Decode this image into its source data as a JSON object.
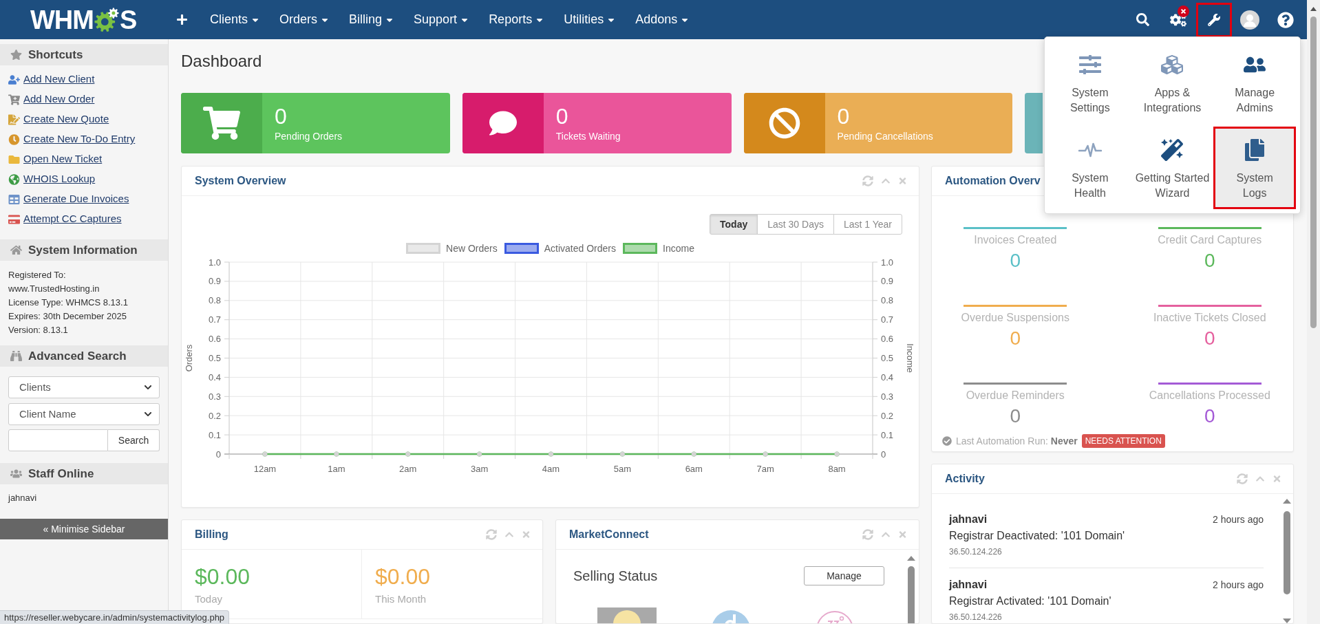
{
  "header": {
    "logo": {
      "text_start": "WHM",
      "text_end": "S"
    },
    "menu": [
      "Clients",
      "Orders",
      "Billing",
      "Support",
      "Reports",
      "Utilities",
      "Addons"
    ],
    "toolbar": [
      {
        "kind": "search",
        "highlighted": false,
        "expanded": false,
        "alert": false
      },
      {
        "kind": "settings",
        "highlighted": false,
        "expanded": false,
        "alert": true
      },
      {
        "kind": "tools",
        "highlighted": true,
        "expanded": true,
        "alert": false
      },
      {
        "kind": "avatar",
        "highlighted": false,
        "expanded": false,
        "alert": false
      },
      {
        "kind": "help",
        "highlighted": false,
        "expanded": false,
        "alert": false
      }
    ]
  },
  "tools_menu": {
    "items": [
      {
        "label": "System\nSettings",
        "highlighted": false
      },
      {
        "label": "Apps &\nIntegrations",
        "highlighted": false
      },
      {
        "label": "Manage\nAdmins",
        "highlighted": false
      },
      {
        "label": "System\nHealth",
        "highlighted": false
      },
      {
        "label": "Getting Started\nWizard",
        "highlighted": false
      },
      {
        "label": "System\nLogs",
        "highlighted": true
      }
    ]
  },
  "sidebar": {
    "shortcuts": {
      "title": "Shortcuts",
      "links": [
        "Add New Client",
        "Add New Order",
        "Create New Quote",
        "Create New To-Do Entry",
        "Open New Ticket",
        "WHOIS Lookup",
        "Generate Due Invoices",
        "Attempt CC Captures"
      ]
    },
    "system_information": {
      "title": "System Information",
      "lines": [
        "Registered To:",
        "www.TrustedHosting.in",
        "License Type: WHMCS 8.13.1",
        "Expires: 30th December 2025",
        "Version: 8.13.1"
      ]
    },
    "advanced_search": {
      "title": "Advanced Search",
      "search_type": "Clients",
      "search_field": "Client Name",
      "button": "Search"
    },
    "staff_online": {
      "title": "Staff Online",
      "names": [
        "jahnavi"
      ]
    },
    "minimise_button": "« Minimise Sidebar"
  },
  "page_title": "Dashboard",
  "stat_cards": [
    {
      "value": "0",
      "label": "Pending Orders",
      "color": "#5dc45d",
      "icon_panel": {
        "color": "#4cad4c"
      }
    },
    {
      "value": "0",
      "label": "Tickets Waiting",
      "color": "#ea559a",
      "icon_panel": {
        "color": "#d71c6c"
      }
    },
    {
      "value": "0",
      "label": "Pending Cancellations",
      "color": "#eaae55",
      "icon_panel": {
        "color": "#d4891c"
      }
    },
    {
      "color": "#6bb4b8"
    }
  ],
  "system_overview": {
    "title": "System Overview",
    "ranges": [
      {
        "label": "Today",
        "selected": true
      },
      {
        "label": "Last 30 Days",
        "selected": false
      },
      {
        "label": "Last 1 Year",
        "selected": false
      }
    ],
    "chart_data": {
      "type": "line",
      "ylabel": "Orders",
      "categories": [
        "12am",
        "1am",
        "2am",
        "3am",
        "4am",
        "5am",
        "6am",
        "7am",
        "8am"
      ],
      "series": [
        {
          "name": "New Orders",
          "color": "#d4d4d4",
          "marker": "circle",
          "values": [
            0,
            0,
            0,
            0,
            0,
            0,
            0,
            0,
            0
          ]
        },
        {
          "name": "Activated Orders",
          "color": "#3a5ae0",
          "values": [
            null,
            null,
            null,
            null,
            null,
            null,
            null,
            null,
            null
          ]
        },
        {
          "name": "Income",
          "color": "#5cb85c",
          "marker": "circle",
          "values": [
            0,
            0,
            0,
            0,
            0,
            0,
            0,
            0,
            0
          ]
        }
      ],
      "ylim": [
        0,
        1
      ],
      "yticks": [
        0,
        0.1,
        0.2,
        0.3,
        0.4,
        0.5,
        0.6,
        0.7,
        0.8,
        0.9,
        {
          "value": 1,
          "label": "1.0"
        }
      ],
      "grid": true,
      "legend": "top"
    },
    "right_axis": {
      "label": "Income",
      "ticks": [
        "1.0",
        "0.9",
        "0.8",
        "0.7",
        "0.6",
        "0.5",
        "0.4",
        "0.3",
        "0.2",
        "0.1",
        "0"
      ]
    }
  },
  "automation_overview": {
    "title": "Automation Overv",
    "stats": [
      {
        "label": "Invoices Created",
        "value": "0",
        "color": "#5bc0c7"
      },
      {
        "label": "Credit Card Captures",
        "value": "0",
        "color": "#5cb85c"
      },
      {
        "label": "Overdue Suspensions",
        "value": "0",
        "color": "#f0ad4e"
      },
      {
        "label": "Inactive Tickets Closed",
        "value": "0",
        "color": "#e5609e"
      },
      {
        "label": "Overdue Reminders",
        "value": "0",
        "color": "#8c8c8c"
      },
      {
        "label": "Cancellations Processed",
        "value": "0",
        "color": "#a45ad6"
      }
    ],
    "last_run": "Last Automation Run: **Never**",
    "badge": "NEEDS ATTENTION"
  },
  "activity": {
    "title": "Activity",
    "entries": [
      {
        "user": "jahnavi",
        "time": "2 hours ago",
        "text": "Registrar Deactivated: '101 Domain'",
        "ip": "36.50.124.226"
      },
      {
        "user": "jahnavi",
        "time": "2 hours ago",
        "text": "Registrar Activated: '101 Domain'",
        "ip": "36.50.124.226"
      }
    ]
  },
  "billing": {
    "title": "Billing",
    "figures": [
      {
        "amount": "$0.00",
        "label": "Today",
        "color": "#5cb85c"
      },
      {
        "amount": "$0.00",
        "label": "This Month",
        "color": "#f0ad4e"
      }
    ]
  },
  "marketconnect": {
    "title": "MarketConnect",
    "heading": "Selling Status",
    "button": "Manage"
  },
  "status_url": "https://reseller.webycare.in/admin/systemactivitylog.php"
}
